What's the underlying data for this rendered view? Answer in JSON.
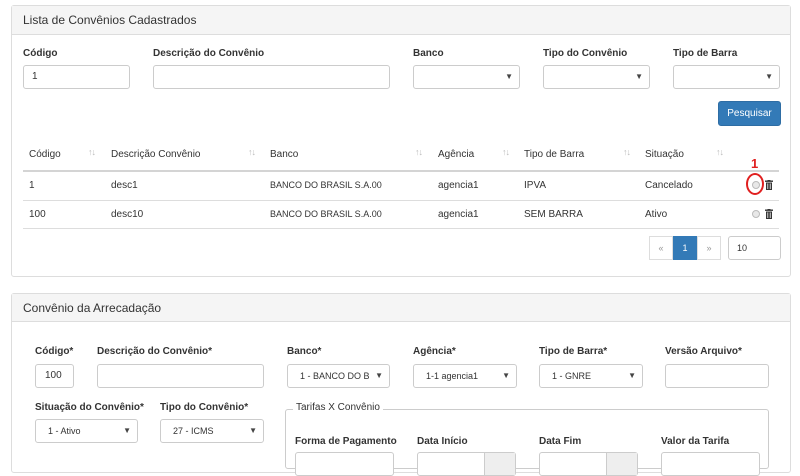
{
  "list_panel": {
    "title": "Lista de Convênios Cadastrados",
    "filters": {
      "codigo_label": "Código",
      "codigo_value": "1",
      "descricao_label": "Descrição do Convênio",
      "descricao_value": "",
      "banco_label": "Banco",
      "tipo_convenio_label": "Tipo do Convênio",
      "tipo_barra_label": "Tipo de Barra"
    },
    "search_button": "Pesquisar",
    "table": {
      "headers": [
        "Código",
        "Descrição Convênio",
        "Banco",
        "Agência",
        "Tipo de Barra",
        "Situação"
      ],
      "rows": [
        [
          "1",
          "desc1",
          "BANCO DO BRASIL S.A.00",
          "agencia1",
          "IPVA",
          "Cancelado"
        ],
        [
          "100",
          "desc10",
          "BANCO DO BRASIL S.A.00",
          "agencia1",
          "SEM BARRA",
          "Ativo"
        ]
      ]
    },
    "annotation": "1",
    "pagination": {
      "prev": "«",
      "current": "1",
      "next": "»",
      "page_size": "10"
    }
  },
  "form_panel": {
    "title": "Convênio da Arrecadação",
    "codigo_label": "Código*",
    "codigo_value": "100",
    "descricao_label": "Descrição do Convênio*",
    "banco_label": "Banco*",
    "banco_value": "1 - BANCO DO B",
    "agencia_label": "Agência*",
    "agencia_value": "1-1 agencia1",
    "tipo_barra_label": "Tipo de Barra*",
    "tipo_barra_value": "1 - GNRE",
    "versao_label": "Versão Arquivo*",
    "situacao_label": "Situação do Convênio*",
    "situacao_value": "1 - Ativo",
    "tipo_convenio_label": "Tipo do Convênio*",
    "tipo_convenio_value": "27 - ICMS",
    "tarifas_legend": "Tarifas X Convênio",
    "forma_pagamento_label": "Forma de Pagamento",
    "data_inicio_label": "Data Início",
    "data_fim_label": "Data Fim",
    "valor_tarifa_label": "Valor da Tarifa"
  },
  "colors": {
    "primary": "#337ab7",
    "annotation": "#e02020"
  },
  "icons": [
    "chevron-down-icon",
    "sort-icon",
    "radio-icon",
    "trash-icon"
  ]
}
